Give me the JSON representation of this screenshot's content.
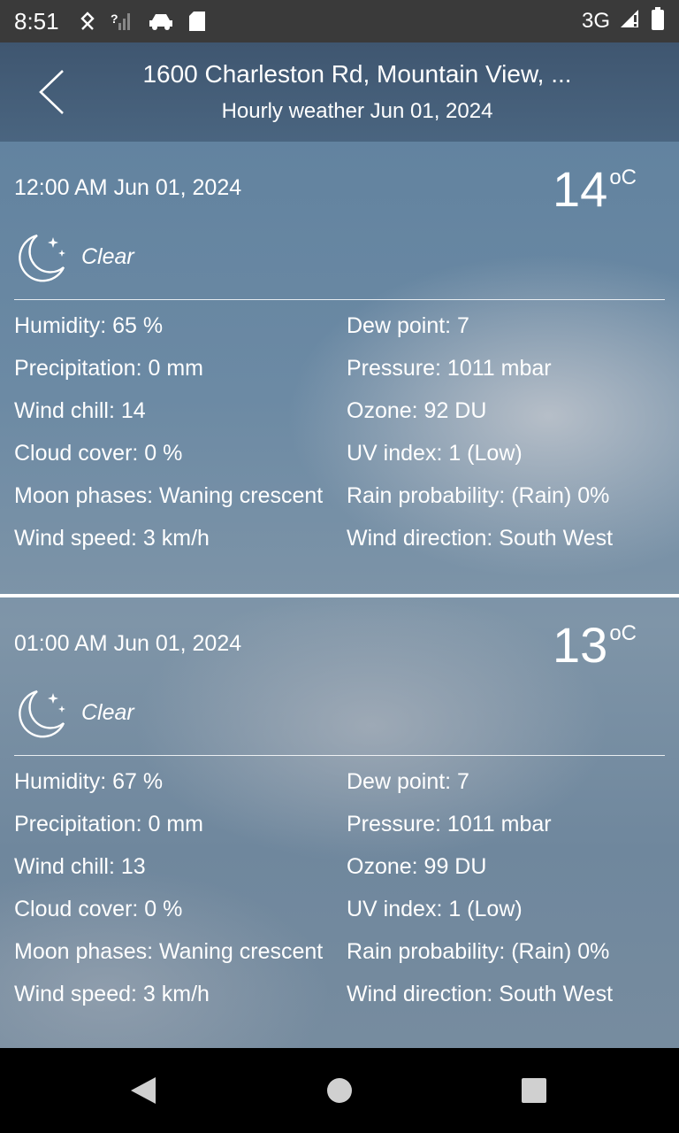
{
  "status_bar": {
    "time": "8:51",
    "network": "3G"
  },
  "header": {
    "title": "1600 Charleston Rd, Mountain View, ...",
    "subtitle": "Hourly weather Jun 01, 2024"
  },
  "hours": [
    {
      "time": "12:00 AM  Jun 01, 2024",
      "temp": "14",
      "unit": "oC",
      "condition": "Clear",
      "icon": "moon-stars-icon",
      "left": [
        "Humidity: 65 %",
        "Precipitation: 0 mm",
        "Wind chill: 14",
        "Cloud cover: 0 %",
        "Moon phases: Waning crescent",
        "Wind speed: 3 km/h"
      ],
      "right": [
        "Dew point: 7",
        "Pressure: 1011 mbar",
        "Ozone: 92 DU",
        "UV index:  1 (Low)",
        "Rain probability: (Rain) 0%",
        "Wind direction: South West"
      ]
    },
    {
      "time": "01:00 AM  Jun 01, 2024",
      "temp": "13",
      "unit": "oC",
      "condition": "Clear",
      "icon": "moon-stars-icon",
      "left": [
        "Humidity: 67 %",
        "Precipitation: 0 mm",
        "Wind chill: 13",
        "Cloud cover: 0 %",
        "Moon phases: Waning crescent",
        "Wind speed: 3 km/h"
      ],
      "right": [
        "Dew point: 7",
        "Pressure: 1011 mbar",
        "Ozone: 99 DU",
        "UV index:  1 (Low)",
        "Rain probability: (Rain) 0%",
        "Wind direction: South West"
      ]
    }
  ],
  "colors": {
    "header_bg": "#3f5670",
    "status_bg": "#3a3a3a",
    "text": "#ffffff"
  }
}
